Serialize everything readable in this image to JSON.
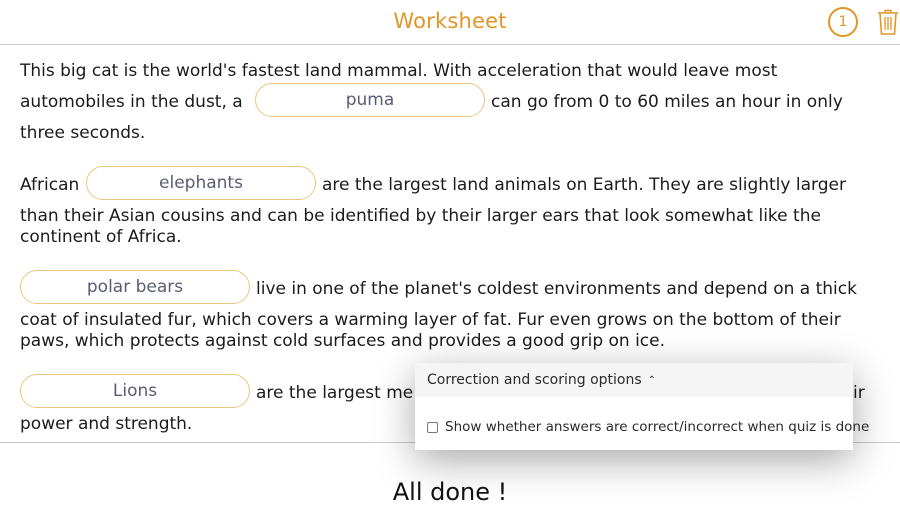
{
  "header": {
    "title": "Worksheet",
    "count": "1"
  },
  "icons": {
    "trash": "trash-icon",
    "chevron": "chevron-up-icon"
  },
  "colors": {
    "accent": "#e29627",
    "blank_border": "#ebc57e",
    "answer_text": "#5a5d72"
  },
  "paragraphs": [
    {
      "line1": "This big cat is the world's fastest land mammal. With acceleration that would leave most",
      "line2_before": "automobiles in the dust, a",
      "answer": "puma",
      "line2_after": "can go from 0 to 60 miles an hour in only",
      "line3": "three seconds."
    },
    {
      "line1_before": "African",
      "answer": "elephants",
      "line1_after": "are the largest land animals on Earth. They are slightly larger",
      "line2": "than their Asian cousins and can be identified by their larger ears that look somewhat like the",
      "line3": "continent of Africa."
    },
    {
      "answer": "polar bears",
      "line1_after": "live in one of the planet's coldest environments and depend on a thick",
      "line2": "coat of insulated fur, which covers a warming layer of fat. Fur even grows on the bottom of their",
      "line3": "paws, which protects against cold surfaces and provides a good grip on ice."
    },
    {
      "answer": "Lions",
      "line1_after": "are the largest me",
      "line1_tail": "ir",
      "line2": "power and strength."
    }
  ],
  "popup": {
    "title": "Correction and scoring options",
    "chevron_glyph": "⌃",
    "option_label": "Show whether answers are correct/incorrect when quiz is done",
    "option_checked": false
  },
  "footer": {
    "message": "All done !"
  }
}
